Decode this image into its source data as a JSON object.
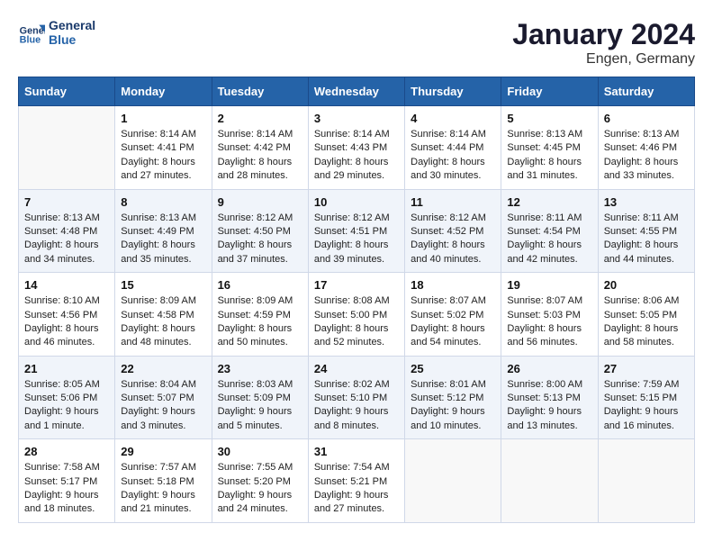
{
  "logo": {
    "line1": "General",
    "line2": "Blue"
  },
  "title": "January 2024",
  "subtitle": "Engen, Germany",
  "headers": [
    "Sunday",
    "Monday",
    "Tuesday",
    "Wednesday",
    "Thursday",
    "Friday",
    "Saturday"
  ],
  "weeks": [
    [
      {
        "day": "",
        "info": ""
      },
      {
        "day": "1",
        "info": "Sunrise: 8:14 AM\nSunset: 4:41 PM\nDaylight: 8 hours\nand 27 minutes."
      },
      {
        "day": "2",
        "info": "Sunrise: 8:14 AM\nSunset: 4:42 PM\nDaylight: 8 hours\nand 28 minutes."
      },
      {
        "day": "3",
        "info": "Sunrise: 8:14 AM\nSunset: 4:43 PM\nDaylight: 8 hours\nand 29 minutes."
      },
      {
        "day": "4",
        "info": "Sunrise: 8:14 AM\nSunset: 4:44 PM\nDaylight: 8 hours\nand 30 minutes."
      },
      {
        "day": "5",
        "info": "Sunrise: 8:13 AM\nSunset: 4:45 PM\nDaylight: 8 hours\nand 31 minutes."
      },
      {
        "day": "6",
        "info": "Sunrise: 8:13 AM\nSunset: 4:46 PM\nDaylight: 8 hours\nand 33 minutes."
      }
    ],
    [
      {
        "day": "7",
        "info": "Sunrise: 8:13 AM\nSunset: 4:48 PM\nDaylight: 8 hours\nand 34 minutes."
      },
      {
        "day": "8",
        "info": "Sunrise: 8:13 AM\nSunset: 4:49 PM\nDaylight: 8 hours\nand 35 minutes."
      },
      {
        "day": "9",
        "info": "Sunrise: 8:12 AM\nSunset: 4:50 PM\nDaylight: 8 hours\nand 37 minutes."
      },
      {
        "day": "10",
        "info": "Sunrise: 8:12 AM\nSunset: 4:51 PM\nDaylight: 8 hours\nand 39 minutes."
      },
      {
        "day": "11",
        "info": "Sunrise: 8:12 AM\nSunset: 4:52 PM\nDaylight: 8 hours\nand 40 minutes."
      },
      {
        "day": "12",
        "info": "Sunrise: 8:11 AM\nSunset: 4:54 PM\nDaylight: 8 hours\nand 42 minutes."
      },
      {
        "day": "13",
        "info": "Sunrise: 8:11 AM\nSunset: 4:55 PM\nDaylight: 8 hours\nand 44 minutes."
      }
    ],
    [
      {
        "day": "14",
        "info": "Sunrise: 8:10 AM\nSunset: 4:56 PM\nDaylight: 8 hours\nand 46 minutes."
      },
      {
        "day": "15",
        "info": "Sunrise: 8:09 AM\nSunset: 4:58 PM\nDaylight: 8 hours\nand 48 minutes."
      },
      {
        "day": "16",
        "info": "Sunrise: 8:09 AM\nSunset: 4:59 PM\nDaylight: 8 hours\nand 50 minutes."
      },
      {
        "day": "17",
        "info": "Sunrise: 8:08 AM\nSunset: 5:00 PM\nDaylight: 8 hours\nand 52 minutes."
      },
      {
        "day": "18",
        "info": "Sunrise: 8:07 AM\nSunset: 5:02 PM\nDaylight: 8 hours\nand 54 minutes."
      },
      {
        "day": "19",
        "info": "Sunrise: 8:07 AM\nSunset: 5:03 PM\nDaylight: 8 hours\nand 56 minutes."
      },
      {
        "day": "20",
        "info": "Sunrise: 8:06 AM\nSunset: 5:05 PM\nDaylight: 8 hours\nand 58 minutes."
      }
    ],
    [
      {
        "day": "21",
        "info": "Sunrise: 8:05 AM\nSunset: 5:06 PM\nDaylight: 9 hours\nand 1 minute."
      },
      {
        "day": "22",
        "info": "Sunrise: 8:04 AM\nSunset: 5:07 PM\nDaylight: 9 hours\nand 3 minutes."
      },
      {
        "day": "23",
        "info": "Sunrise: 8:03 AM\nSunset: 5:09 PM\nDaylight: 9 hours\nand 5 minutes."
      },
      {
        "day": "24",
        "info": "Sunrise: 8:02 AM\nSunset: 5:10 PM\nDaylight: 9 hours\nand 8 minutes."
      },
      {
        "day": "25",
        "info": "Sunrise: 8:01 AM\nSunset: 5:12 PM\nDaylight: 9 hours\nand 10 minutes."
      },
      {
        "day": "26",
        "info": "Sunrise: 8:00 AM\nSunset: 5:13 PM\nDaylight: 9 hours\nand 13 minutes."
      },
      {
        "day": "27",
        "info": "Sunrise: 7:59 AM\nSunset: 5:15 PM\nDaylight: 9 hours\nand 16 minutes."
      }
    ],
    [
      {
        "day": "28",
        "info": "Sunrise: 7:58 AM\nSunset: 5:17 PM\nDaylight: 9 hours\nand 18 minutes."
      },
      {
        "day": "29",
        "info": "Sunrise: 7:57 AM\nSunset: 5:18 PM\nDaylight: 9 hours\nand 21 minutes."
      },
      {
        "day": "30",
        "info": "Sunrise: 7:55 AM\nSunset: 5:20 PM\nDaylight: 9 hours\nand 24 minutes."
      },
      {
        "day": "31",
        "info": "Sunrise: 7:54 AM\nSunset: 5:21 PM\nDaylight: 9 hours\nand 27 minutes."
      },
      {
        "day": "",
        "info": ""
      },
      {
        "day": "",
        "info": ""
      },
      {
        "day": "",
        "info": ""
      }
    ]
  ]
}
